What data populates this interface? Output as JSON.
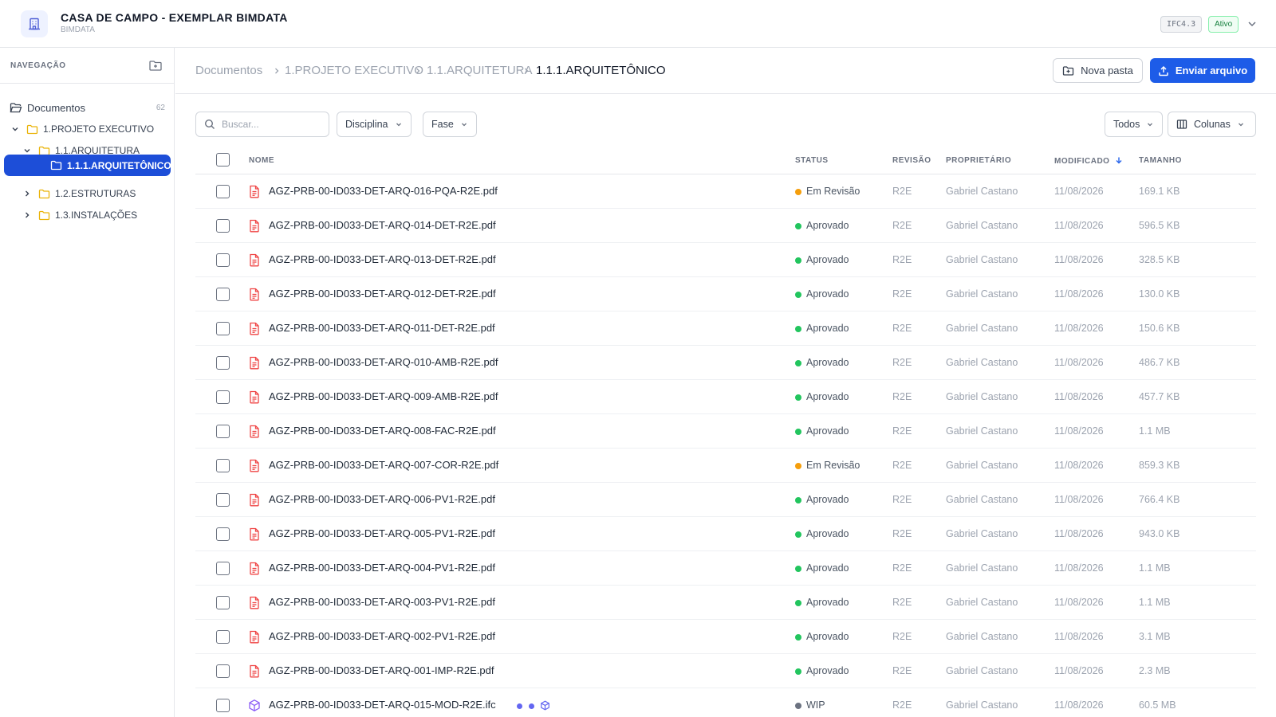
{
  "header": {
    "title": "CASA DE CAMPO - EXEMPLAR BIMDATA",
    "subtitle": "BIMDATA",
    "ifc_badge": "IFC4.3",
    "status": "Ativo",
    "logo_icon": "building-icon"
  },
  "sidebar": {
    "title": "NAVEGAÇÃO",
    "root": {
      "label": "Documentos",
      "count": "62"
    },
    "items": [
      {
        "label": "1.PROJETO EXECUTIVO",
        "expanded": true
      },
      {
        "label": "1.1.ARQUITETURA",
        "expanded": true
      },
      {
        "label": "1.1.1.ARQUITETÔNICO",
        "active": true
      },
      {
        "label": "1.2.ESTRUTURAS",
        "expanded": false
      },
      {
        "label": "1.3.INSTALAÇÕES",
        "expanded": false
      }
    ]
  },
  "breadcrumb": [
    "Documentos",
    "1.PROJETO EXECUTIVO",
    "1.1.ARQUITETURA",
    "1.1.1.ARQUITETÔNICO"
  ],
  "actions": {
    "new_folder": "Nova pasta",
    "upload": "Enviar arquivo"
  },
  "filters": {
    "search_placeholder": "Buscar...",
    "discipline": "Disciplina",
    "phase": "Fase",
    "scope": "Todos",
    "columns": "Colunas"
  },
  "table": {
    "columns": {
      "name": "NOME",
      "status": "STATUS",
      "revision": "REVISÃO",
      "owner": "PROPRIETÁRIO",
      "modified": "MODIFICADO",
      "size": "TAMANHO"
    },
    "status_colors": {
      "Em Revisão": "#f59e0b",
      "Aprovado": "#22c55e",
      "WIP": "#6b7280"
    },
    "rows": [
      {
        "name": "AGZ-PRB-00-ID033-DET-ARQ-016-PQA-R2E.pdf",
        "type": "pdf",
        "status": "Em Revisão",
        "revision": "R2E",
        "owner": "Gabriel Castano",
        "modified": "11/08/2026",
        "size": "169.1 KB"
      },
      {
        "name": "AGZ-PRB-00-ID033-DET-ARQ-014-DET-R2E.pdf",
        "type": "pdf",
        "status": "Aprovado",
        "revision": "R2E",
        "owner": "Gabriel Castano",
        "modified": "11/08/2026",
        "size": "596.5 KB"
      },
      {
        "name": "AGZ-PRB-00-ID033-DET-ARQ-013-DET-R2E.pdf",
        "type": "pdf",
        "status": "Aprovado",
        "revision": "R2E",
        "owner": "Gabriel Castano",
        "modified": "11/08/2026",
        "size": "328.5 KB"
      },
      {
        "name": "AGZ-PRB-00-ID033-DET-ARQ-012-DET-R2E.pdf",
        "type": "pdf",
        "status": "Aprovado",
        "revision": "R2E",
        "owner": "Gabriel Castano",
        "modified": "11/08/2026",
        "size": "130.0 KB"
      },
      {
        "name": "AGZ-PRB-00-ID033-DET-ARQ-011-DET-R2E.pdf",
        "type": "pdf",
        "status": "Aprovado",
        "revision": "R2E",
        "owner": "Gabriel Castano",
        "modified": "11/08/2026",
        "size": "150.6 KB"
      },
      {
        "name": "AGZ-PRB-00-ID033-DET-ARQ-010-AMB-R2E.pdf",
        "type": "pdf",
        "status": "Aprovado",
        "revision": "R2E",
        "owner": "Gabriel Castano",
        "modified": "11/08/2026",
        "size": "486.7 KB"
      },
      {
        "name": "AGZ-PRB-00-ID033-DET-ARQ-009-AMB-R2E.pdf",
        "type": "pdf",
        "status": "Aprovado",
        "revision": "R2E",
        "owner": "Gabriel Castano",
        "modified": "11/08/2026",
        "size": "457.7 KB"
      },
      {
        "name": "AGZ-PRB-00-ID033-DET-ARQ-008-FAC-R2E.pdf",
        "type": "pdf",
        "status": "Aprovado",
        "revision": "R2E",
        "owner": "Gabriel Castano",
        "modified": "11/08/2026",
        "size": "1.1 MB"
      },
      {
        "name": "AGZ-PRB-00-ID033-DET-ARQ-007-COR-R2E.pdf",
        "type": "pdf",
        "status": "Em Revisão",
        "revision": "R2E",
        "owner": "Gabriel Castano",
        "modified": "11/08/2026",
        "size": "859.3 KB"
      },
      {
        "name": "AGZ-PRB-00-ID033-DET-ARQ-006-PV1-R2E.pdf",
        "type": "pdf",
        "status": "Aprovado",
        "revision": "R2E",
        "owner": "Gabriel Castano",
        "modified": "11/08/2026",
        "size": "766.4 KB"
      },
      {
        "name": "AGZ-PRB-00-ID033-DET-ARQ-005-PV1-R2E.pdf",
        "type": "pdf",
        "status": "Aprovado",
        "revision": "R2E",
        "owner": "Gabriel Castano",
        "modified": "11/08/2026",
        "size": "943.0 KB"
      },
      {
        "name": "AGZ-PRB-00-ID033-DET-ARQ-004-PV1-R2E.pdf",
        "type": "pdf",
        "status": "Aprovado",
        "revision": "R2E",
        "owner": "Gabriel Castano",
        "modified": "11/08/2026",
        "size": "1.1 MB"
      },
      {
        "name": "AGZ-PRB-00-ID033-DET-ARQ-003-PV1-R2E.pdf",
        "type": "pdf",
        "status": "Aprovado",
        "revision": "R2E",
        "owner": "Gabriel Castano",
        "modified": "11/08/2026",
        "size": "1.1 MB"
      },
      {
        "name": "AGZ-PRB-00-ID033-DET-ARQ-002-PV1-R2E.pdf",
        "type": "pdf",
        "status": "Aprovado",
        "revision": "R2E",
        "owner": "Gabriel Castano",
        "modified": "11/08/2026",
        "size": "3.1 MB"
      },
      {
        "name": "AGZ-PRB-00-ID033-DET-ARQ-001-IMP-R2E.pdf",
        "type": "pdf",
        "status": "Aprovado",
        "revision": "R2E",
        "owner": "Gabriel Castano",
        "modified": "11/08/2026",
        "size": "2.3 MB"
      },
      {
        "name": "AGZ-PRB-00-ID033-DET-ARQ-015-MOD-R2E.ifc",
        "type": "ifc",
        "status": "WIP",
        "revision": "R2E",
        "owner": "Gabriel Castano",
        "modified": "11/08/2026",
        "size": "60.5 MB"
      }
    ]
  },
  "colors": {
    "accent": "#1d5ce8",
    "active_nav": "#1d4ed8",
    "pdf_icon": "#ef4444",
    "ifc_icon": "#8b5cf6"
  }
}
